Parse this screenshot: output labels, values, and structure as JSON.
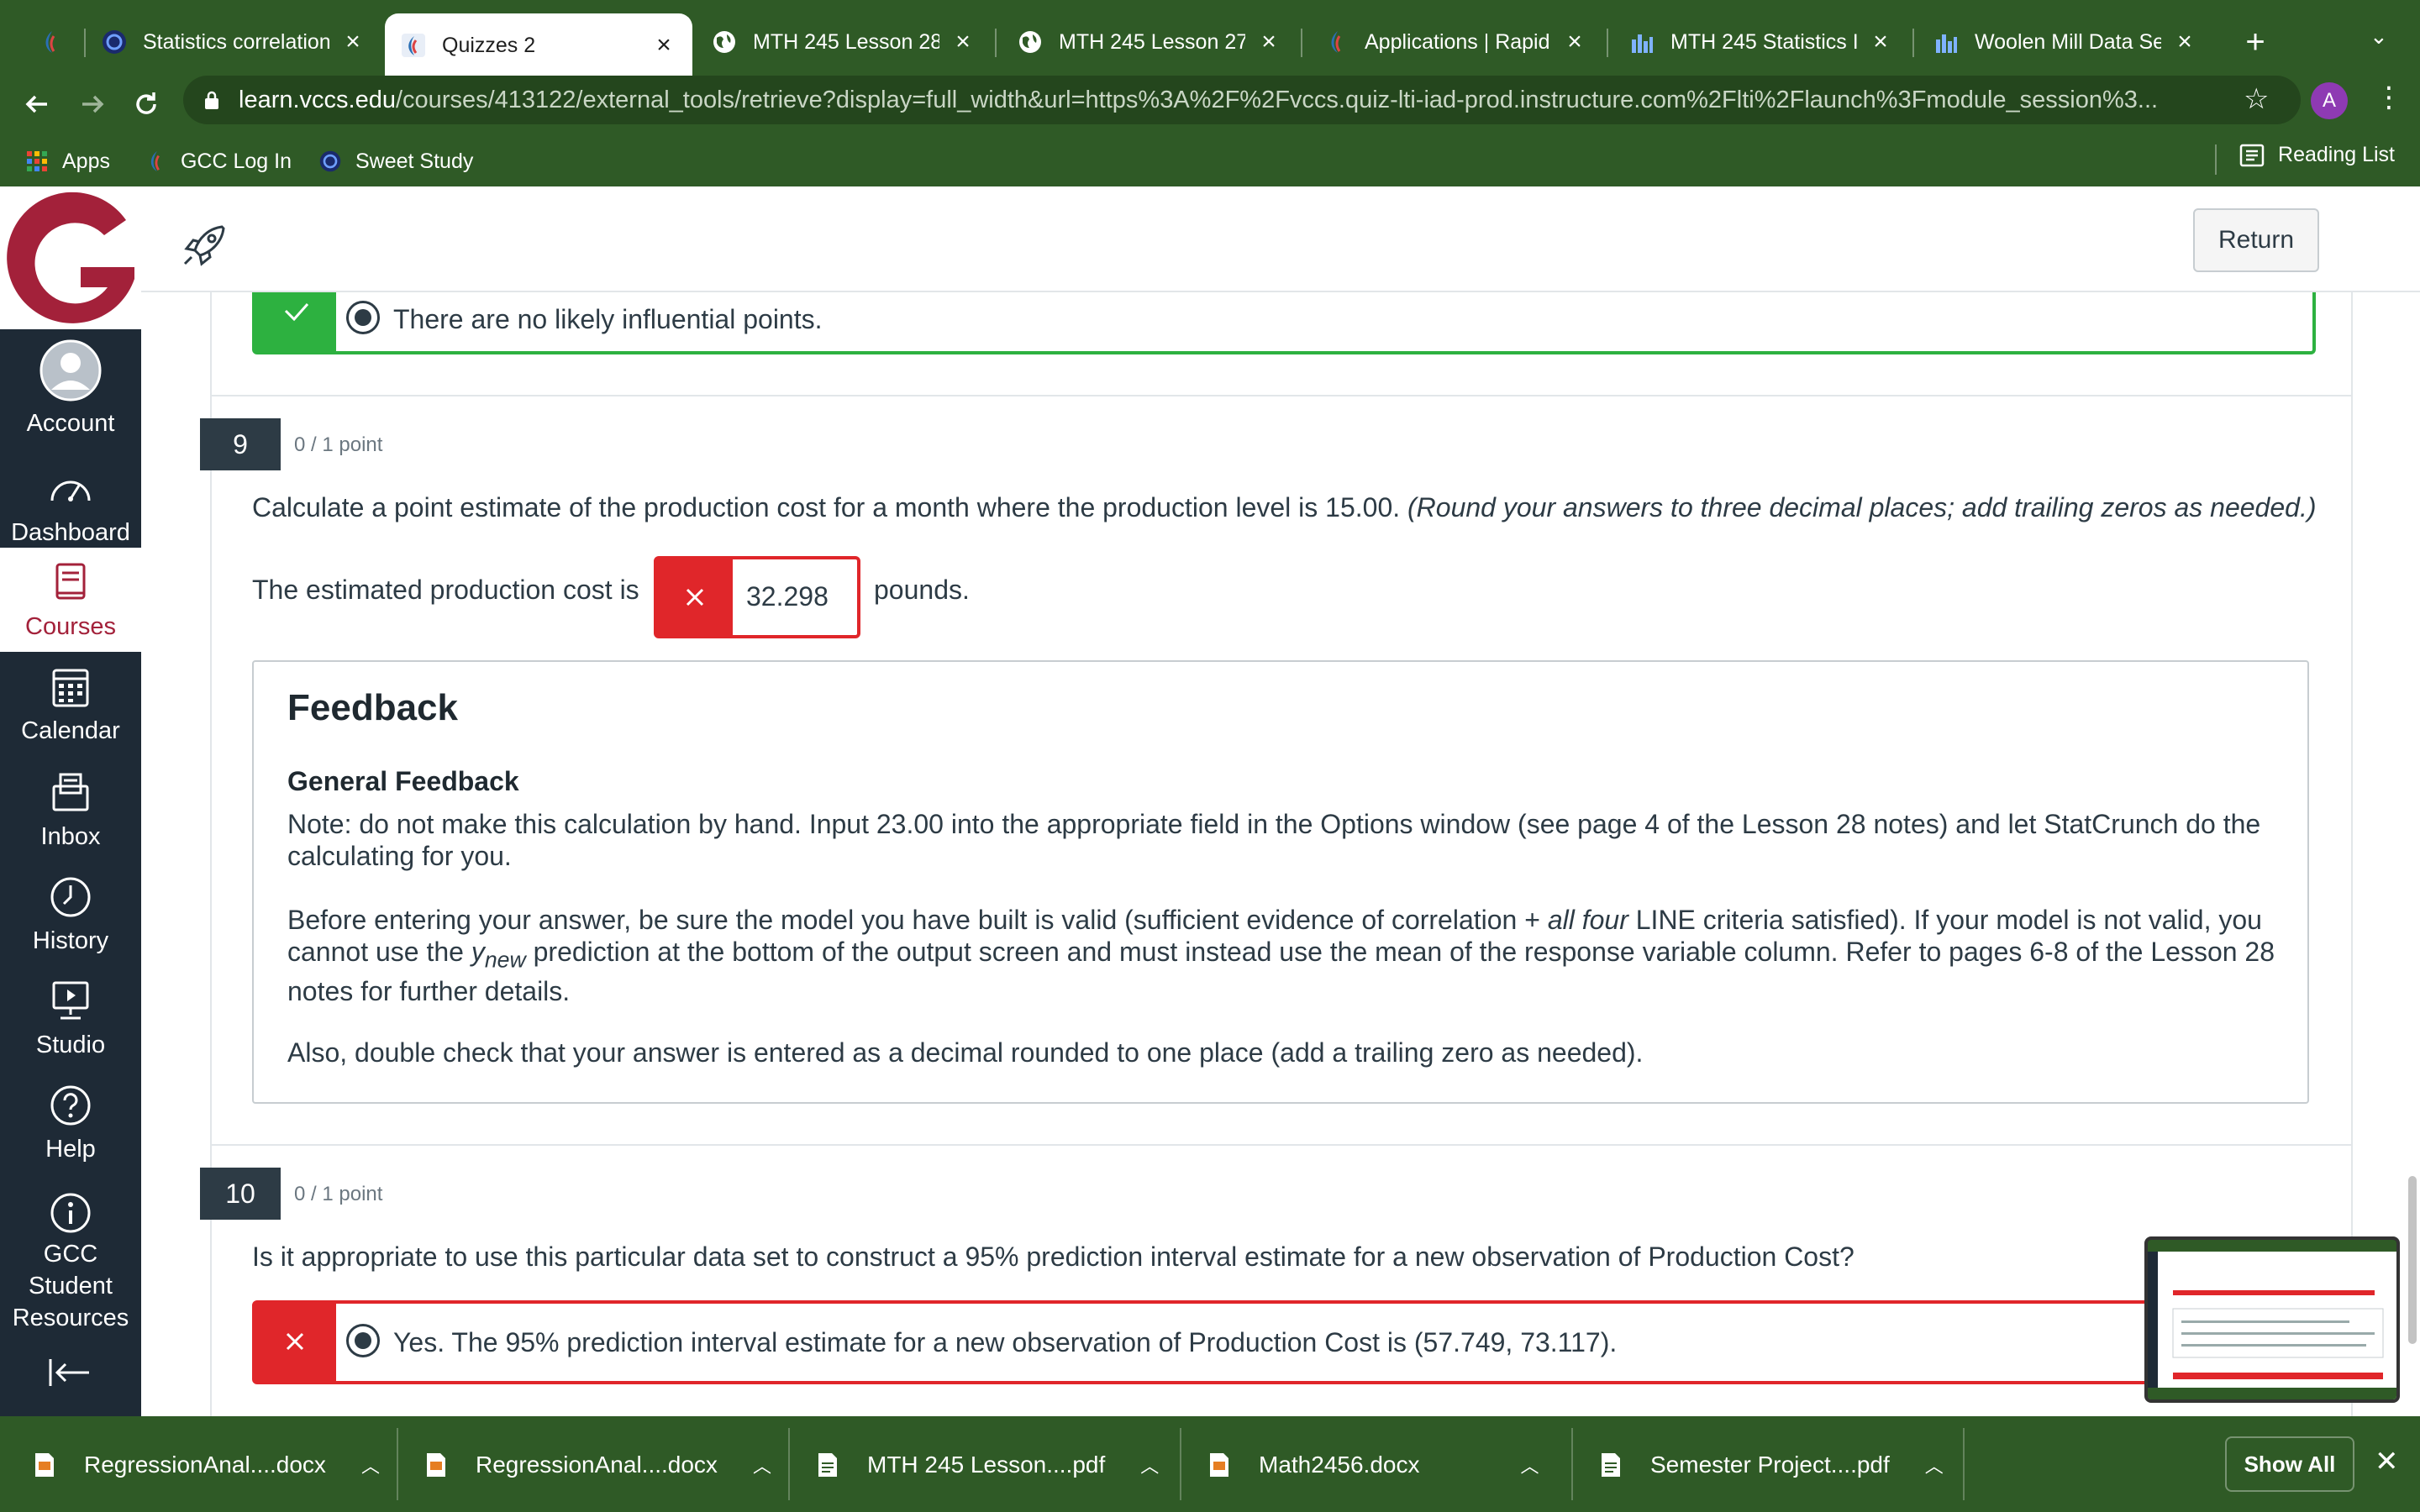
{
  "browser": {
    "tabs": [
      {
        "label": "",
        "icon": "canvas-icon",
        "active": false
      },
      {
        "label": "Statistics correlation",
        "icon": "course-hero-icon",
        "active": false
      },
      {
        "label": "Quizzes 2",
        "icon": "canvas-icon",
        "active": true
      },
      {
        "label": "MTH 245 Lesson 28",
        "icon": "globe-icon",
        "active": false
      },
      {
        "label": "MTH 245 Lesson 27",
        "icon": "globe-icon",
        "active": false
      },
      {
        "label": "Applications | Rapidi",
        "icon": "canvas-icon",
        "active": false
      },
      {
        "label": "MTH 245 Statistics I",
        "icon": "statcrunch-icon",
        "active": false
      },
      {
        "label": "Woolen Mill Data Set",
        "icon": "statcrunch-icon",
        "active": false
      }
    ],
    "url_host": "learn.vccs.edu",
    "url_path": "/courses/413122/external_tools/retrieve?display=full_width&url=https%3A%2F%2Fvccs.quiz-lti-iad-prod.instructure.com%2Flti%2Flaunch%3Fmodule_session%3...",
    "profile_initial": "A",
    "bookmarks": [
      {
        "label": "Apps"
      },
      {
        "label": "GCC Log In"
      },
      {
        "label": "Sweet Study"
      }
    ],
    "reading_list": "Reading List"
  },
  "lms": {
    "nav": {
      "account": "Account",
      "dashboard": "Dashboard",
      "courses": "Courses",
      "calendar": "Calendar",
      "inbox": "Inbox",
      "history": "History",
      "studio": "Studio",
      "help": "Help",
      "resources": "GCC Student Resources"
    },
    "return_label": "Return",
    "accent": "#a3213a"
  },
  "quiz": {
    "prev_answer": "There are no likely influential points.",
    "q9": {
      "number": "9",
      "points": "0 / 1 point",
      "text": "Calculate a point estimate of the production cost for a month where the production level is 15.00.",
      "hint": "(Round your answers to three decimal places; add trailing zeros as needed.)",
      "prefix": "The estimated production cost is",
      "answer": "32.298",
      "suffix": "pounds."
    },
    "feedback": {
      "title": "Feedback",
      "subtitle": "General Feedback",
      "p1": "Note: do not make this calculation by hand. Input 23.00 into the appropriate field in the Options window (see page 4 of the Lesson 28 notes) and let StatCrunch do the calculating for you.",
      "p2_a": "Before entering your answer, be sure the model you have built is valid (sufficient evidence of correlation + ",
      "p2_em": "all four",
      "p2_b": " LINE criteria satisfied). If your model is not valid, you cannot use the ",
      "p2_y": "y",
      "p2_sub": "new",
      "p2_c": " prediction at the bottom of the output screen and must instead use the mean of the response variable column. Refer to pages 6-8 of the Lesson 28 notes for further details.",
      "p3": "Also, double check that your answer is entered as a decimal rounded to one place (add a trailing zero as needed)."
    },
    "q10": {
      "number": "10",
      "points": "0 / 1 point",
      "text": "Is it appropriate to use this particular data set to construct a 95% prediction interval estimate for a new observation of Production Cost?",
      "answer": "Yes. The 95% prediction interval estimate for a new observation of Production Cost is (57.749, 73.117)."
    }
  },
  "downloads": {
    "items": [
      {
        "label": "RegressionAnal....docx",
        "type": "docx"
      },
      {
        "label": "RegressionAnal....docx",
        "type": "docx"
      },
      {
        "label": "MTH 245 Lesson....pdf",
        "type": "pdf"
      },
      {
        "label": "Math2456.docx",
        "type": "docx"
      },
      {
        "label": "Semester Project....pdf",
        "type": "pdf"
      }
    ],
    "show_all": "Show All"
  }
}
